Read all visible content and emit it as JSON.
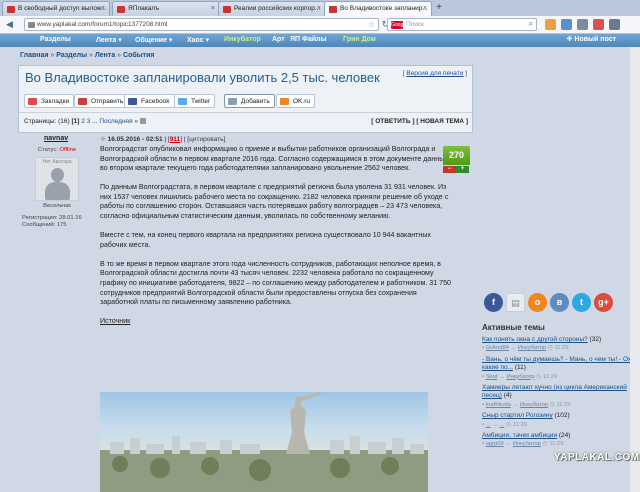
{
  "browser": {
    "tabs": [
      {
        "label": "В свободный доступ вылож...",
        "active": false
      },
      {
        "label": "ЯПлакалъ",
        "active": false
      },
      {
        "label": "Реалии российских корпор...",
        "active": false
      },
      {
        "label": "Во Владивостоке запланир...",
        "active": true
      }
    ],
    "new_tab": "+",
    "url": "www.yaplakal.com/forum1/topic1377208.html",
    "search_placeholder": "Поиск",
    "search_engine": "Google"
  },
  "site_nav": {
    "items": [
      "Разделы",
      "Лента ▾",
      "Общение ▾",
      "Хаос ▾",
      "Инкубатор",
      "Арт",
      "ЯП Файлы",
      "Грин Дом"
    ],
    "new_post": "✚ Новый пост"
  },
  "breadcrumbs": [
    "Главная",
    "Разделы",
    "Лента",
    "События"
  ],
  "topic": {
    "title": "Во Владивостоке запланировали уволить 2,5 тыс. человек",
    "print_label": "Версия для печати",
    "share_buttons": [
      "Закладки",
      "Отправить",
      "Facebook",
      "Twitter",
      "Добавить",
      "OK.ru"
    ],
    "pages_label": "Страницы:",
    "pages_count": "(16)",
    "current_page": "[1]",
    "page_links": [
      "2",
      "3"
    ],
    "last_label": "Последняя »",
    "reply_label": "ОТВЕТИТЬ",
    "new_topic_label": "НОВАЯ ТЕМА"
  },
  "post": {
    "author": "navnav",
    "date": "16.05.2016 - 02:51",
    "number": "911",
    "quote_label": "цитировать",
    "status_label": "Статус:",
    "status_value": "Offline",
    "no_avatar": "Нет Аватара",
    "rank": "Весельчак",
    "registered": "Регистрация: 28.01.16",
    "messages": "Сообщений: 175",
    "rating": "270",
    "paragraphs": [
      "Волгоградстат опубликовал информацию о приеме и выбытии работников организаций Волгограда и Волгоградской области в первом квартале 2016 года. Согласно содержащимся в этом документе данным, во втором квартале текущего года работодателями запланировано увольнение 2562 человек.",
      "По данным Волгоградстата, в первом квартале с предприятий региона была уволена 31 931 человек. Из них 1537 человек лишились рабочего места по сокращению. 2182 человека приняли решение об уходе с работы по соглашению сторон. Оставшаяся часть потерявших работу волгоградцев – 23 473 человека, согласно официальным статистическим данным, уволилась по собственному желанию.",
      "Вместе с тем, на конец первого квартала на предприятиях региона существовало 10 944 вакантных рабочих места.",
      "В то же время в первом квартале этого года численность сотрудников, работающих неполное время, в Волгоградской области достигла почти 43 тысяч человек. 2232 человека работало по сокращенному графику по инициативе работодателя, 9822 – по соглашению между работодателем и работником. 31 750 сотрудников предприятий Волгоградской области были предоставлены отпуска без сохранения заработной платы по письменному заявлению работника."
    ],
    "source_label": "Источник"
  },
  "sidebar": {
    "active_title": "Активные темы",
    "topics": [
      {
        "title": "Как понять окна с другой стороны?",
        "count": "(32)",
        "user": "GrAnd84",
        "section": "Инкубатор",
        "time": "11:29"
      },
      {
        "title": "- Вань, о чём ты думаешь? - Мань, о чем ты! - Ох, какие по...",
        "count": "(11)",
        "user": "Skat",
        "section": "Инкубатор",
        "time": "11:29"
      },
      {
        "title": "Хамиеры летают кучно (из цикла Американский песец)",
        "count": "(4)",
        "user": "kraft4cola",
        "section": "Инкубатор",
        "time": "11:29"
      },
      {
        "title": "Сныр стартил Рогозину",
        "count": "(102)",
        "user": "...",
        "section": "...",
        "time": "11:29"
      },
      {
        "title": "Амбиции, тачки амбиции",
        "count": "(24)",
        "user": "agrp09",
        "section": "Инкубатор",
        "time": "11:29"
      }
    ]
  },
  "watermark": "YAPLAKAL.COM",
  "colors": {
    "link": "#1a4f8a",
    "title": "#1f5f95",
    "rating": "#5fa824",
    "nav": "#5a93c6"
  }
}
